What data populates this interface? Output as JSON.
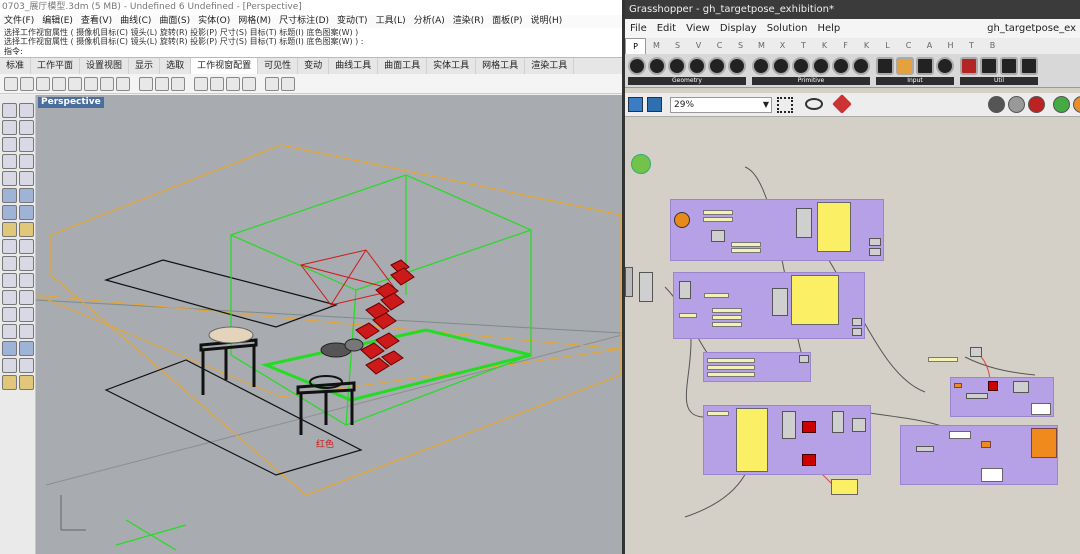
{
  "rhino": {
    "title": "0703_展厅模型.3dm (5 MB) - Undefined 6 Undefined - [Perspective]",
    "menu": [
      "文件(F)",
      "编辑(E)",
      "查看(V)",
      "曲线(C)",
      "曲面(S)",
      "实体(O)",
      "网格(M)",
      "尺寸标注(D)",
      "变动(T)",
      "工具(L)",
      "分析(A)",
      "渲染(R)",
      "面板(P)",
      "说明(H)"
    ],
    "history": [
      "选择工作视窗属性 ( 摄像机目标(C)   镜头(L)   旋转(R)   投影(P)   尺寸(S)   目标(T)   标题(I)   底色图案(W) )",
      "选择工作视窗属性 ( 摄像机目标(C)   镜头(L)   旋转(R)   投影(P)   尺寸(S)   目标(T)   标题(I)   底色图案(W) ) :"
    ],
    "command_prompt": "指令:",
    "tabs": [
      "标准",
      "工作平面",
      "设置视图",
      "显示",
      "选取",
      "工作视窗配置",
      "可见性",
      "变动",
      "曲线工具",
      "曲面工具",
      "实体工具",
      "网格工具",
      "渲染工具"
    ],
    "active_tab": "工作视窗配置",
    "viewport_label": "Perspective",
    "scene_label": "红色"
  },
  "gh": {
    "title": "Grasshopper - gh_targetpose_exhibition*",
    "menu": [
      "File",
      "Edit",
      "View",
      "Display",
      "Solution",
      "Help"
    ],
    "doc_tab": "gh_targetpose_ex",
    "component_tabs": [
      "P",
      "M",
      "S",
      "V",
      "C",
      "S",
      "M",
      "X",
      "T",
      "K",
      "F",
      "K",
      "L",
      "C",
      "A",
      "H",
      "T",
      "B"
    ],
    "ribbon_groups": [
      "Geometry",
      "Primitive",
      "Input",
      "Util"
    ],
    "zoom": "29%"
  },
  "colors": {
    "gh_group": "#b7a1e6",
    "panel_yellow": "#fbef66",
    "viewport_bg": "#a8abaf",
    "layer_orange": "#e8a631",
    "layer_green": "#22dd22",
    "target_red": "#cc1a1a"
  }
}
